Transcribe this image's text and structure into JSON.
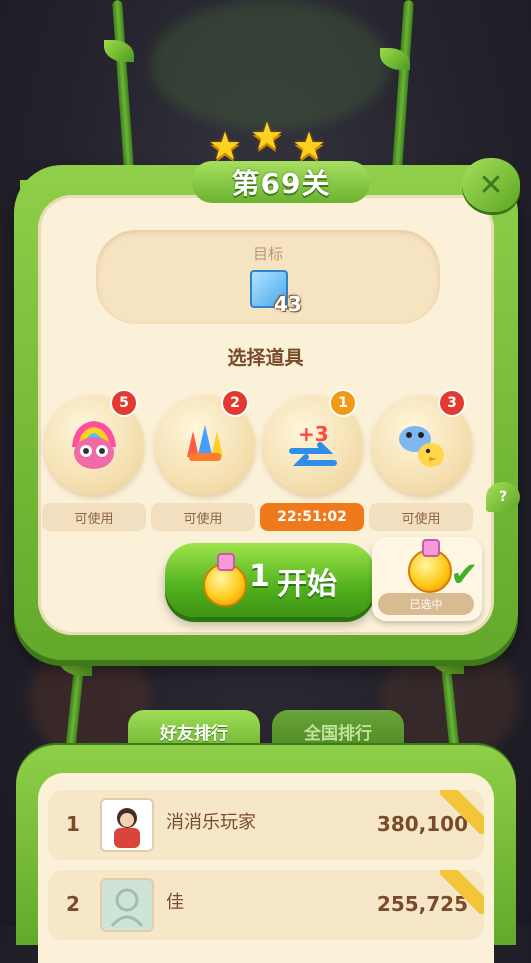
{
  "level": {
    "title": "第69关",
    "stars": 3
  },
  "goal": {
    "label": "目标",
    "count": "43"
  },
  "boosters": {
    "section_title": "选择道具",
    "items": [
      {
        "icon": "rainbow-owl-icon",
        "badge": "5",
        "status": "可使用"
      },
      {
        "icon": "rocket-bundle-icon",
        "badge": "2",
        "status": "可使用"
      },
      {
        "icon": "plus-three-moves-icon",
        "badge": "1",
        "status": "22:51:02"
      },
      {
        "icon": "hippo-chick-icon",
        "badge": "3",
        "status": "可使用"
      }
    ]
  },
  "start": {
    "count": "1",
    "label": "开始"
  },
  "selected": {
    "label": "已选中"
  },
  "help": {
    "label": "?"
  },
  "close": {
    "label": "✕"
  },
  "leaderboard": {
    "tabs": [
      {
        "label": "好友排行"
      },
      {
        "label": "全国排行"
      }
    ],
    "rows": [
      {
        "rank": "1",
        "name": "消消乐玩家",
        "score": "380,100"
      },
      {
        "rank": "2",
        "name": "佳",
        "score": "255,725"
      }
    ]
  },
  "colors": {
    "panel_green": "#8fcf49",
    "cream": "#fbf1d8",
    "timer_orange": "#f07a1b",
    "badge_red": "#e23a2e"
  }
}
